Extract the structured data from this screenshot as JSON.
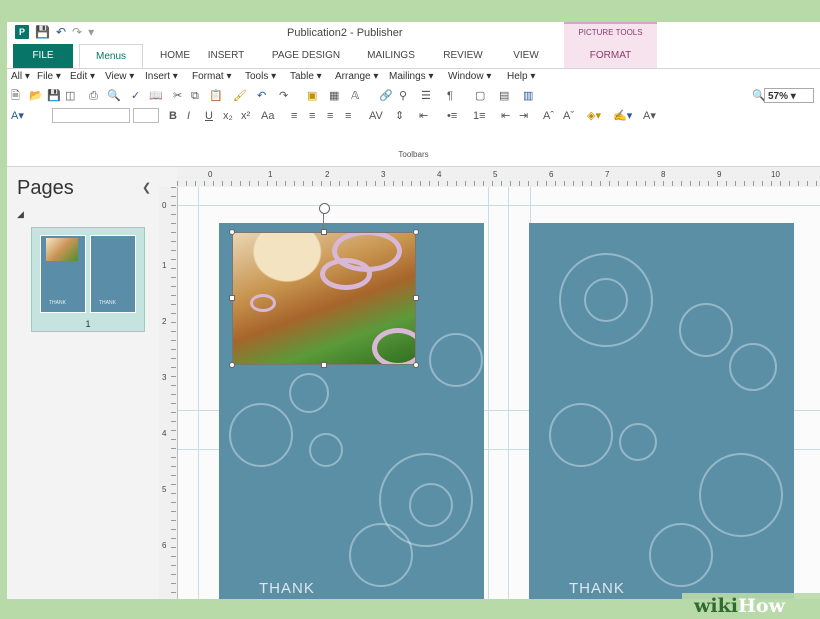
{
  "titlebar": {
    "title": "Publication2 - Publisher",
    "picture_tools": "PICTURE TOOLS",
    "logo": "P"
  },
  "tabs": [
    "FILE",
    "Menus",
    "HOME",
    "INSERT",
    "PAGE DESIGN",
    "MAILINGS",
    "REVIEW",
    "VIEW",
    "FORMAT"
  ],
  "menubar": [
    "All",
    "File",
    "Edit",
    "View",
    "Insert",
    "Format",
    "Tools",
    "Table",
    "Arrange",
    "Mailings",
    "Window",
    "Help"
  ],
  "toolbar": {
    "zoom": "57%",
    "toolbars_label": "Toolbars"
  },
  "pages_pane": {
    "title": "Pages",
    "page_number": "1"
  },
  "ruler": {
    "horizontal": [
      "0",
      "1",
      "2",
      "3",
      "4",
      "5",
      "6",
      "7",
      "8",
      "9",
      "10"
    ],
    "vertical": [
      "0",
      "1",
      "2",
      "3",
      "4",
      "5",
      "6"
    ]
  },
  "document": {
    "left_page_text": "THANK",
    "right_page_text": "THANK",
    "thumb_text": "THANK"
  },
  "watermark": {
    "wiki": "wiki",
    "how": "How"
  },
  "colors": {
    "accent": "#077568",
    "page_background": "#5b8fa6",
    "picture_tools": "#f6e3ee"
  },
  "icons": [
    "publisher-logo",
    "save-icon",
    "undo-icon",
    "redo-icon",
    "new-icon",
    "open-icon",
    "print-icon",
    "print-preview-icon",
    "spelling-icon",
    "cut-icon",
    "copy-icon",
    "paste-icon",
    "format-painter-icon",
    "zoom-icon",
    "bold-icon",
    "italic-icon",
    "underline-icon"
  ]
}
